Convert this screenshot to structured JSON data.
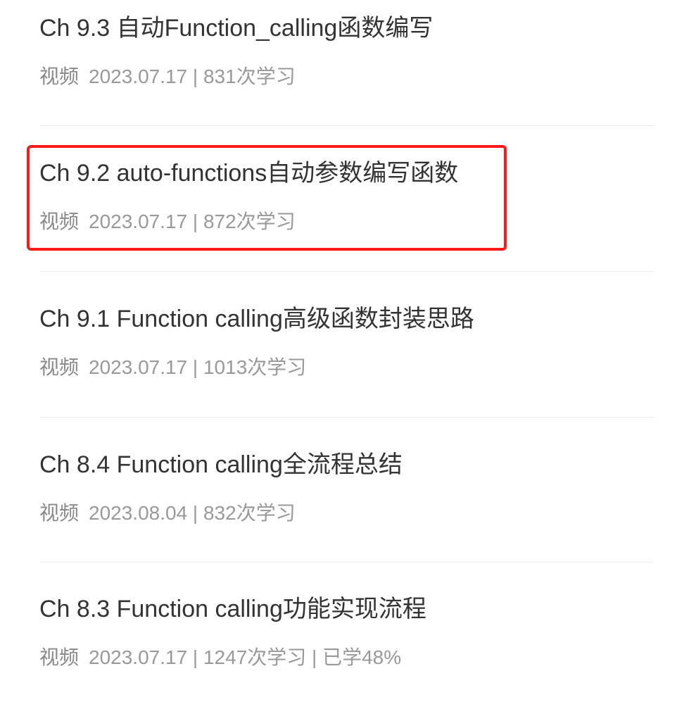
{
  "courses": [
    {
      "title": "Ch 9.3 自动Function_calling函数编写",
      "type": "视频",
      "stats": "2023.07.17 | 831次学习"
    },
    {
      "title": "Ch 9.2 auto-functions自动参数编写函数",
      "type": "视频",
      "stats": "2023.07.17 | 872次学习"
    },
    {
      "title": "Ch 9.1 Function calling高级函数封装思路",
      "type": "视频",
      "stats": "2023.07.17 | 1013次学习"
    },
    {
      "title": "Ch 8.4 Function calling全流程总结",
      "type": "视频",
      "stats": "2023.08.04 | 832次学习"
    },
    {
      "title": "Ch 8.3 Function calling功能实现流程",
      "type": "视频",
      "stats": "2023.07.17 | 1247次学习 | 已学48%"
    }
  ],
  "highlight": {
    "color": "#ff1a1a",
    "target": "Ch 9.2 auto-functions自动参数编写函数"
  }
}
